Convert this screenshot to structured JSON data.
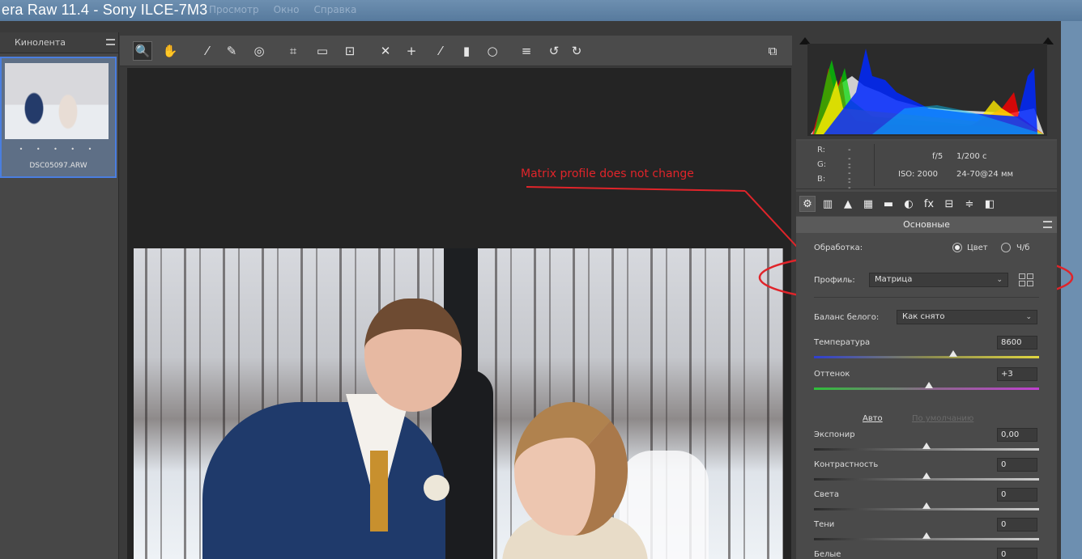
{
  "app": {
    "title": "era Raw 11.4  -  Sony ILCE-7M3",
    "menus": [
      "Просмотр",
      "Окно",
      "Справка"
    ]
  },
  "filmstrip": {
    "header": "Кинолента",
    "thumbnail": {
      "stars": "• • • • •",
      "filename": "DSC05097.ARW"
    }
  },
  "toolbar": {
    "tools": [
      {
        "icon": "zoom-icon",
        "glyph": "🔍"
      },
      {
        "icon": "hand-icon",
        "glyph": "✋"
      },
      {
        "icon": "white-balance-icon",
        "glyph": "⁄"
      },
      {
        "icon": "color-sampler-icon",
        "glyph": "✎"
      },
      {
        "icon": "targeted-adjustment-icon",
        "glyph": "◎"
      },
      {
        "icon": "crop-icon",
        "glyph": "⌗"
      },
      {
        "icon": "straighten-icon",
        "glyph": "▭"
      },
      {
        "icon": "transform-icon",
        "glyph": "⊡"
      },
      {
        "icon": "spot-removal-icon",
        "glyph": "✕"
      },
      {
        "icon": "red-eye-icon",
        "glyph": "+"
      },
      {
        "icon": "adjustment-brush-icon",
        "glyph": "⁄"
      },
      {
        "icon": "graduated-filter-icon",
        "glyph": "▮"
      },
      {
        "icon": "radial-filter-icon",
        "glyph": "○"
      },
      {
        "icon": "preferences-icon",
        "glyph": "≡"
      },
      {
        "icon": "rotate-left-icon",
        "glyph": "↺"
      },
      {
        "icon": "rotate-right-icon",
        "glyph": "↻"
      }
    ],
    "fullscreen_icon": "⧉"
  },
  "annotation": {
    "text": "Matrix profile does not change",
    "color": "#e0242a"
  },
  "histogram": {
    "readout": {
      "r_label": "R:",
      "g_label": "G:",
      "b_label": "B:",
      "r": "---",
      "g": "---",
      "b": "---"
    },
    "meta": {
      "aperture": "f/5",
      "shutter": "1/200 с",
      "iso": "ISO: 2000",
      "lens": "24-70@24 мм"
    }
  },
  "panel_tabs": [
    "⚙",
    "▥",
    "▲",
    "▦",
    "▬",
    "◐",
    "fx",
    "⊟",
    "≑",
    "◧"
  ],
  "basic": {
    "section_title": "Основные",
    "processing_label": "Обработка:",
    "color_label": "Цвет",
    "bw_label": "Ч/б",
    "profile_label": "Профиль:",
    "profile_value": "Матрица",
    "wb_label": "Баланс белого:",
    "wb_value": "Как снято",
    "auto_label": "Авто",
    "default_label": "По умолчанию",
    "sliders": [
      {
        "label": "Температура",
        "value": "8600",
        "position": 0.62
      },
      {
        "label": "Оттенок",
        "value": "+3",
        "position": 0.51
      },
      {
        "label": "Экспонир",
        "value": "0,00",
        "position": 0.5
      },
      {
        "label": "Контрастность",
        "value": "0",
        "position": 0.5
      },
      {
        "label": "Света",
        "value": "0",
        "position": 0.5
      },
      {
        "label": "Тени",
        "value": "0",
        "position": 0.5
      },
      {
        "label": "Белые",
        "value": "0",
        "position": 0.5
      }
    ]
  }
}
